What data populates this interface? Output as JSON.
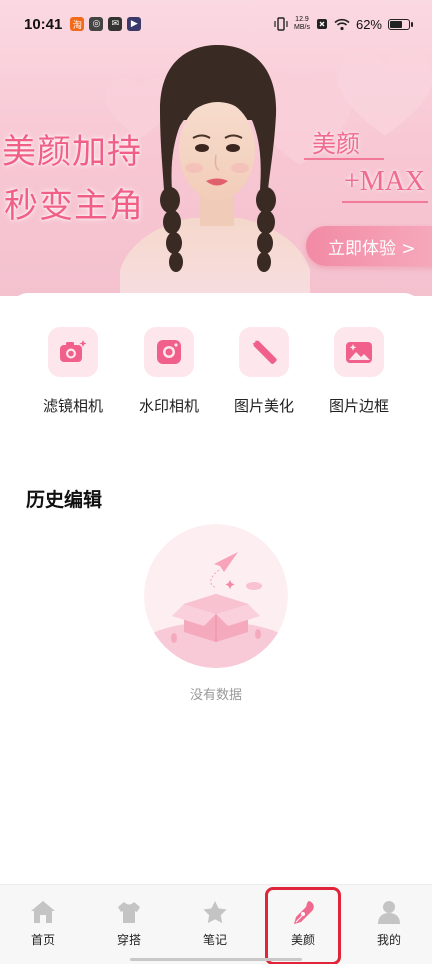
{
  "status_bar": {
    "time": "10:41",
    "net_speed_value": "12.9",
    "net_speed_unit": "MB/s",
    "battery": "62%",
    "battery_level": 0.62
  },
  "banner": {
    "title_line1": "美颜加持",
    "title_line2": "秒变主角",
    "product_label": "美颜",
    "max_label": "+MAX",
    "cta_button": "立即体验 >"
  },
  "tools": [
    {
      "label": "滤镜相机",
      "icon": "camera-sparkle-icon"
    },
    {
      "label": "水印相机",
      "icon": "camera-icon"
    },
    {
      "label": "图片美化",
      "icon": "magic-wand-icon"
    },
    {
      "label": "图片边框",
      "icon": "image-frame-icon"
    }
  ],
  "history": {
    "title": "历史编辑",
    "empty_text": "没有数据"
  },
  "bottom_nav": {
    "items": [
      {
        "label": "首页",
        "icon": "home-icon"
      },
      {
        "label": "穿搭",
        "icon": "shirt-icon"
      },
      {
        "label": "笔记",
        "icon": "star-note-icon"
      },
      {
        "label": "美颜",
        "icon": "pen-nib-icon"
      },
      {
        "label": "我的",
        "icon": "user-icon"
      }
    ],
    "active_index": 3
  },
  "colors": {
    "accent": "#f15f86",
    "banner_bg": "#f7c6d2",
    "icon_tile": "#fde6ec",
    "icon_fill": "#f0608a",
    "highlight": "#e0243a"
  }
}
